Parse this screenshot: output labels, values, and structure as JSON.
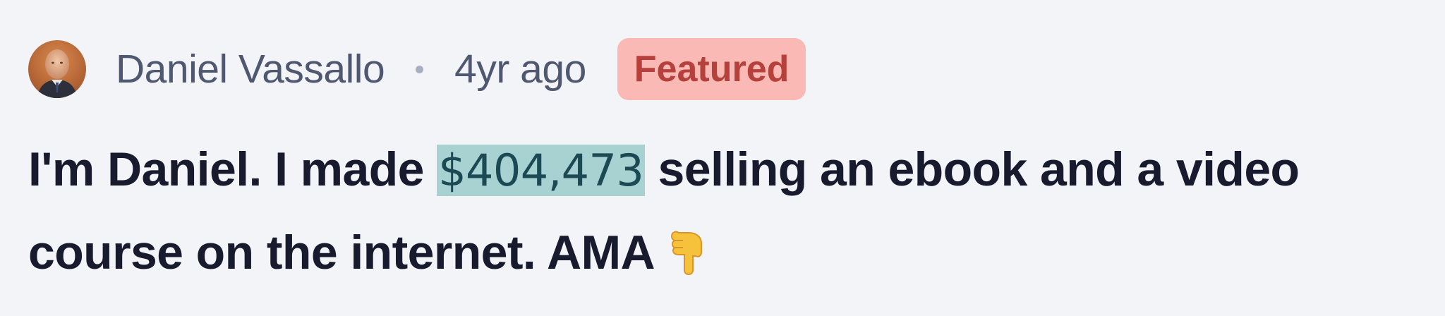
{
  "post": {
    "author": {
      "name": "Daniel Vassallo",
      "avatar_icon": "avatar-photo"
    },
    "separator": "·",
    "time_ago": "4yr ago",
    "badge": {
      "label": "Featured",
      "background": "#fbb9b5",
      "color": "#b6403b"
    },
    "title": {
      "before": "I'm Daniel. I made ",
      "highlight": "$404,473",
      "after": " selling an ebook and a video course on the internet. AMA",
      "emoji": "pointing-down-hand-icon",
      "highlight_color": "#a8d1d2"
    }
  },
  "colors": {
    "background": "#f3f4f8",
    "meta_text": "#4f5870",
    "headline_text": "#171b2d"
  }
}
